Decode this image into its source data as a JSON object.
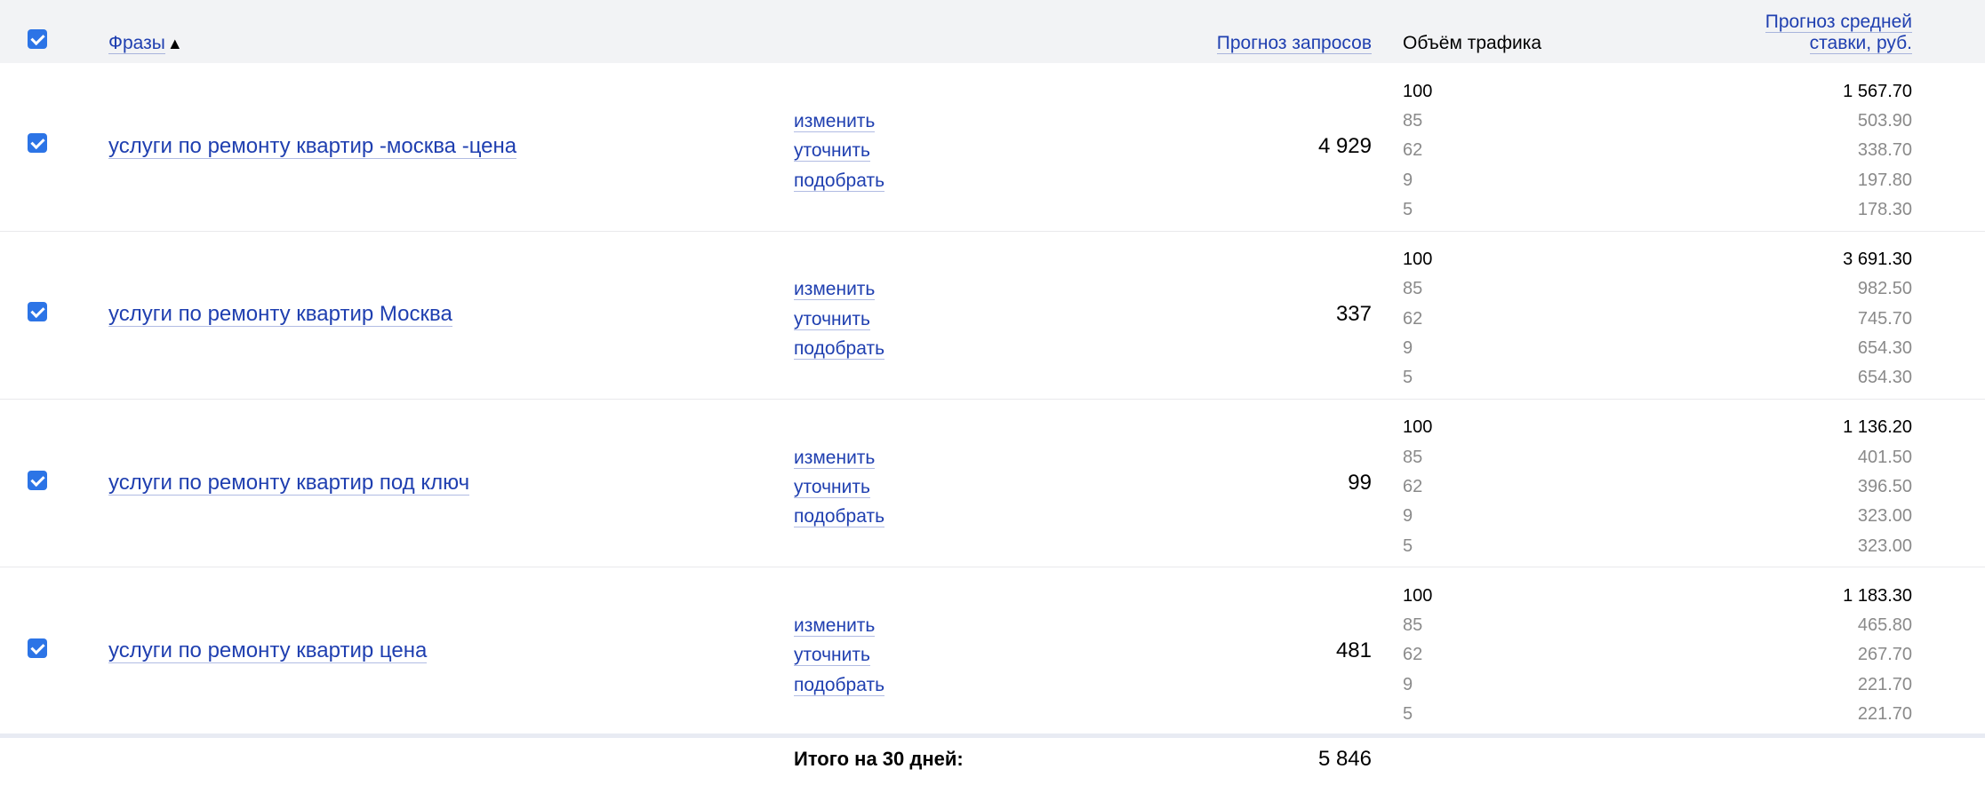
{
  "header": {
    "phrases_label": "Фразы",
    "sort_arrow": "▲",
    "forecast_requests_label": "Прогноз запросов",
    "traffic_volume_label": "Объём трафика",
    "avg_bid_label_line1": "Прогноз средней",
    "avg_bid_label_line2": "ставки, руб."
  },
  "actions": {
    "change": "изменить",
    "refine": "уточнить",
    "pick": "подобрать"
  },
  "rows": [
    {
      "phrase": "услуги по ремонту квартир -москва -цена",
      "requests": "4 929",
      "traffic": [
        "100",
        "85",
        "62",
        "9",
        "5"
      ],
      "bids": [
        "1 567.70",
        "503.90",
        "338.70",
        "197.80",
        "178.30"
      ]
    },
    {
      "phrase": "услуги по ремонту квартир Москва",
      "requests": "337",
      "traffic": [
        "100",
        "85",
        "62",
        "9",
        "5"
      ],
      "bids": [
        "3 691.30",
        "982.50",
        "745.70",
        "654.30",
        "654.30"
      ]
    },
    {
      "phrase": "услуги по ремонту квартир под ключ",
      "requests": "99",
      "traffic": [
        "100",
        "85",
        "62",
        "9",
        "5"
      ],
      "bids": [
        "1 136.20",
        "401.50",
        "396.50",
        "323.00",
        "323.00"
      ]
    },
    {
      "phrase": "услуги по ремонту квартир цена",
      "requests": "481",
      "traffic": [
        "100",
        "85",
        "62",
        "9",
        "5"
      ],
      "bids": [
        "1 183.30",
        "465.80",
        "267.70",
        "221.70",
        "221.70"
      ]
    }
  ],
  "footer": {
    "total_label": "Итого на 30 дней:",
    "total_value": "5 846"
  },
  "colors": {
    "link": "#1f3fb0",
    "checkbox": "#2c74e6",
    "header_bg": "#f2f3f5",
    "muted_text": "#8a8a8a"
  }
}
